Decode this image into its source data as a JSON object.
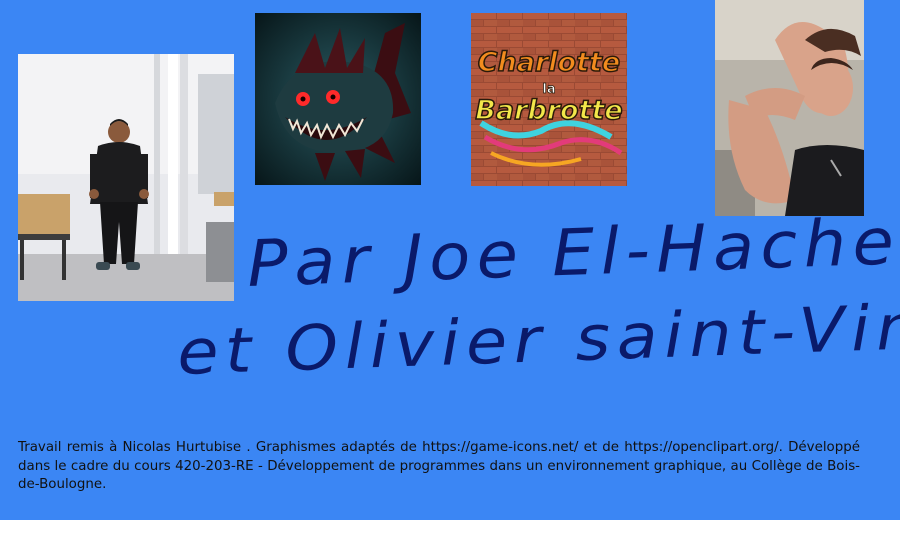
{
  "signature": {
    "line1": "Par Joe El-Hachem",
    "line2": "et Olivier saint-Vincent"
  },
  "credits": {
    "text": "Travail remis à Nicolas Hurtubise                       . Graphismes adaptés de https://game-icons.net/ et de https://openclipart.org/. Développé dans le cadre du cours 420-203-RE - Développement de programmes dans un environnement graphique, au Collège de Bois-de-Boulogne."
  },
  "logo": {
    "word1": "Charlotte",
    "word2": "la",
    "word3": "Barbrotte"
  },
  "colors": {
    "background": "#3b86f4",
    "ink": "#0a1a6a"
  }
}
